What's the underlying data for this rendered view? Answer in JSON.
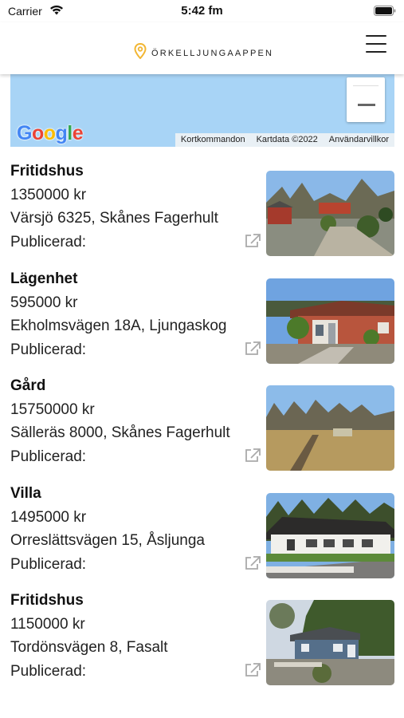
{
  "status_bar": {
    "carrier": "Carrier",
    "time": "5:42 fm"
  },
  "header": {
    "app_name": "ÖRKELLJUNGAAPPEN",
    "logo_icon": "map-pin-icon",
    "menu_icon": "hamburger-menu-icon"
  },
  "map": {
    "provider_logo": "Google",
    "attribution": [
      "Kortkommandon",
      "Kartdata ©2022",
      "Användarvillkor"
    ],
    "water_color": "#a8d4f6"
  },
  "listings": [
    {
      "type": "Fritidshus",
      "price": "1350000 kr",
      "address": "Värsjö 6325, Skånes Fagerhult",
      "published": "Publicerad:"
    },
    {
      "type": "Lägenhet",
      "price": "595000 kr",
      "address": "Ekholmsvägen 18A, Ljungaskog",
      "published": "Publicerad:"
    },
    {
      "type": "Gård",
      "price": "15750000 kr",
      "address": "Sälleräs 8000, Skånes Fagerhult",
      "published": "Publicerad:"
    },
    {
      "type": "Villa",
      "price": "1495000 kr",
      "address": "Orreslättsvägen 15, Åsljunga",
      "published": "Publicerad:"
    },
    {
      "type": "Fritidshus",
      "price": "1150000 kr",
      "address": "Tordönsvägen 8, Fasalt",
      "published": "Publicerad:"
    }
  ],
  "colors": {
    "accent": "#f2b632"
  }
}
